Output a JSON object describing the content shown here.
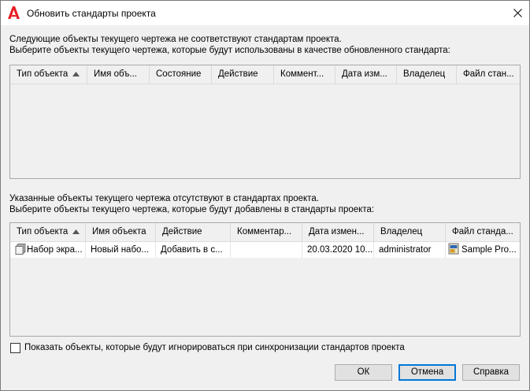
{
  "window": {
    "title": "Обновить стандарты проекта"
  },
  "section1": {
    "line1": "Следующие объекты текущего чертежа не соответствуют стандартам проекта.",
    "line2": "Выберите объекты текущего чертежа, которые будут использованы в качестве обновленного стандарта:",
    "columns": [
      "Тип объекта",
      "Имя объ...",
      "Состояние",
      "Действие",
      "Коммент...",
      "Дата изм...",
      "Владелец",
      "Файл стан..."
    ]
  },
  "section2": {
    "line1": "Указанные объекты текущего чертежа отсутствуют в стандартах проекта.",
    "line2": "Выберите объекты текущего чертежа, которые будут добавлены в стандарты проекта:",
    "columns": [
      "Тип объекта",
      "Имя объекта",
      "Действие",
      "Комментар...",
      "Дата измен...",
      "Владелец",
      "Файл станда..."
    ],
    "rows": [
      {
        "type": "Набор экра...",
        "name": "Новый набо...",
        "action": "Добавить в с...",
        "comment": "",
        "date": "20.03.2020 10...",
        "owner": "administrator",
        "file": "Sample Pro..."
      }
    ]
  },
  "checkbox": {
    "label": "Показать объекты, которые будут игнорироваться при синхронизации стандартов проекта",
    "checked": false
  },
  "buttons": {
    "ok": "ОК",
    "cancel": "Отмена",
    "help": "Справка"
  },
  "icons": {
    "app": "autocad-logo-icon",
    "close": "close-icon",
    "sort": "sort-ascending-icon",
    "sheet_set": "sheet-set-icon",
    "standards_file": "standards-file-icon"
  },
  "colors": {
    "logo_red": "#e51f24",
    "default_button_border": "#0078d7",
    "dialog_bg": "#f0f0f0"
  }
}
